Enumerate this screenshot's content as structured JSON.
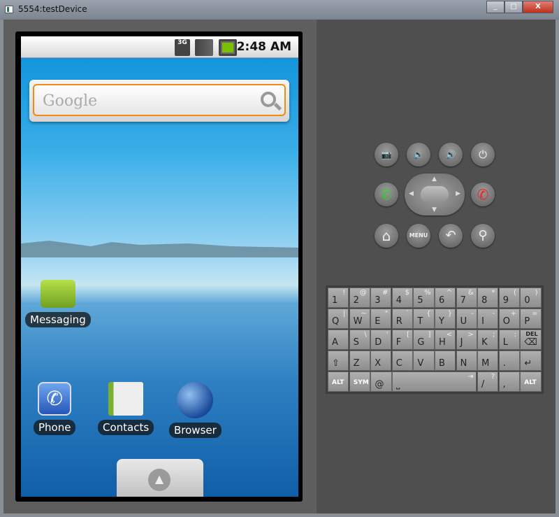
{
  "window": {
    "title": "5554:testDevice",
    "minimize": "_",
    "maximize": "□",
    "close": "X"
  },
  "statusbar": {
    "network": "3G",
    "signal_icon": "signal-bars-icon",
    "battery_icon": "battery-charging-icon",
    "time": "2:48 AM"
  },
  "search": {
    "placeholder": "Google",
    "icon": "search-icon"
  },
  "apps": [
    {
      "label": "Messaging",
      "icon": "messaging-icon"
    },
    {
      "label": "Phone",
      "icon": "phone-icon"
    },
    {
      "label": "Contacts",
      "icon": "contacts-icon"
    },
    {
      "label": "Browser",
      "icon": "browser-icon"
    }
  ],
  "controls": {
    "camera": "📷",
    "vol_down": "🔉",
    "vol_up": "🔊",
    "power": "⏻",
    "call": "✆",
    "end": "✆",
    "home": "⌂",
    "menu": "MENU",
    "back": "↶",
    "search": "⚲"
  },
  "keyboard": {
    "rows": [
      [
        [
          "1",
          "!"
        ],
        [
          "2",
          "@"
        ],
        [
          "3",
          "#"
        ],
        [
          "4",
          "$"
        ],
        [
          "5",
          "%"
        ],
        [
          "6",
          "^"
        ],
        [
          "7",
          "&"
        ],
        [
          "8",
          "*"
        ],
        [
          "9",
          "("
        ],
        [
          "0",
          ")"
        ]
      ],
      [
        [
          "Q",
          "|"
        ],
        [
          "W",
          "~"
        ],
        [
          "E",
          "\""
        ],
        [
          "R",
          "`"
        ],
        [
          "T",
          "{"
        ],
        [
          "Y",
          "}"
        ],
        [
          "U",
          "-"
        ],
        [
          "I",
          "-"
        ],
        [
          "O",
          "+"
        ],
        [
          "P",
          "="
        ]
      ],
      [
        [
          "A",
          ""
        ],
        [
          "S",
          "\\"
        ],
        [
          "D",
          "'"
        ],
        [
          "F",
          "["
        ],
        [
          "G",
          "]"
        ],
        [
          "H",
          "<"
        ],
        [
          "J",
          ">"
        ],
        [
          "K",
          ";"
        ],
        [
          "L",
          ":"
        ],
        [
          "⌫",
          "DEL"
        ]
      ],
      [
        [
          "⇧",
          ""
        ],
        [
          "Z",
          ""
        ],
        [
          "X",
          ""
        ],
        [
          "C",
          ""
        ],
        [
          "V",
          ""
        ],
        [
          "B",
          ""
        ],
        [
          "N",
          ""
        ],
        [
          "M",
          ""
        ],
        [
          ".",
          ""
        ],
        [
          "↵",
          ""
        ]
      ],
      [
        [
          "ALT",
          ""
        ],
        [
          "SYM",
          ""
        ],
        [
          "@",
          ""
        ],
        [
          "⎵",
          "⇥"
        ],
        [
          "/",
          "?"
        ],
        [
          ",",
          ""
        ],
        [
          "ALT",
          ""
        ]
      ]
    ]
  }
}
